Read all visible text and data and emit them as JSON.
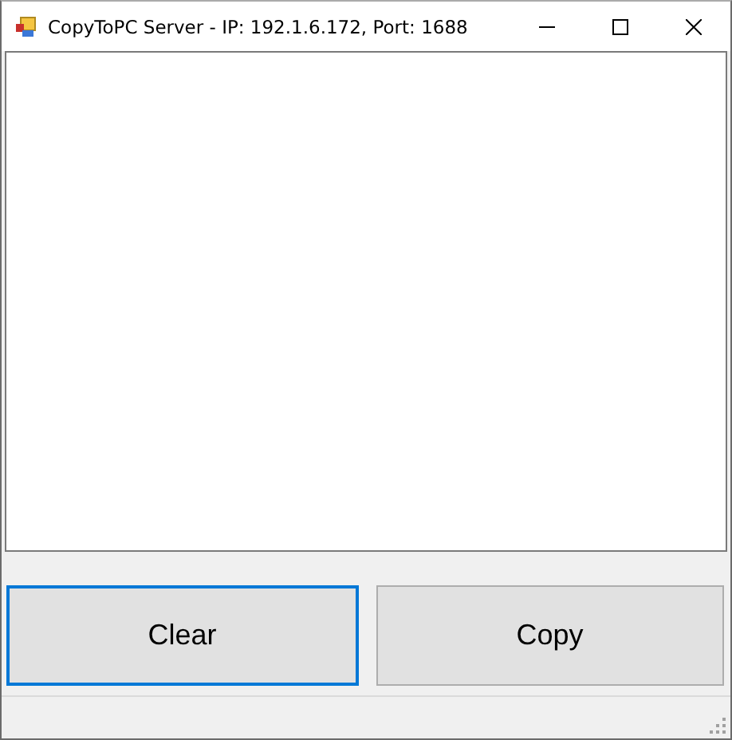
{
  "window": {
    "title": "CopyToPC Server - IP: 192.1.6.172, Port: 1688"
  },
  "buttons": [
    {
      "label": "Clear",
      "focused": true
    },
    {
      "label": "Copy",
      "focused": false
    }
  ]
}
